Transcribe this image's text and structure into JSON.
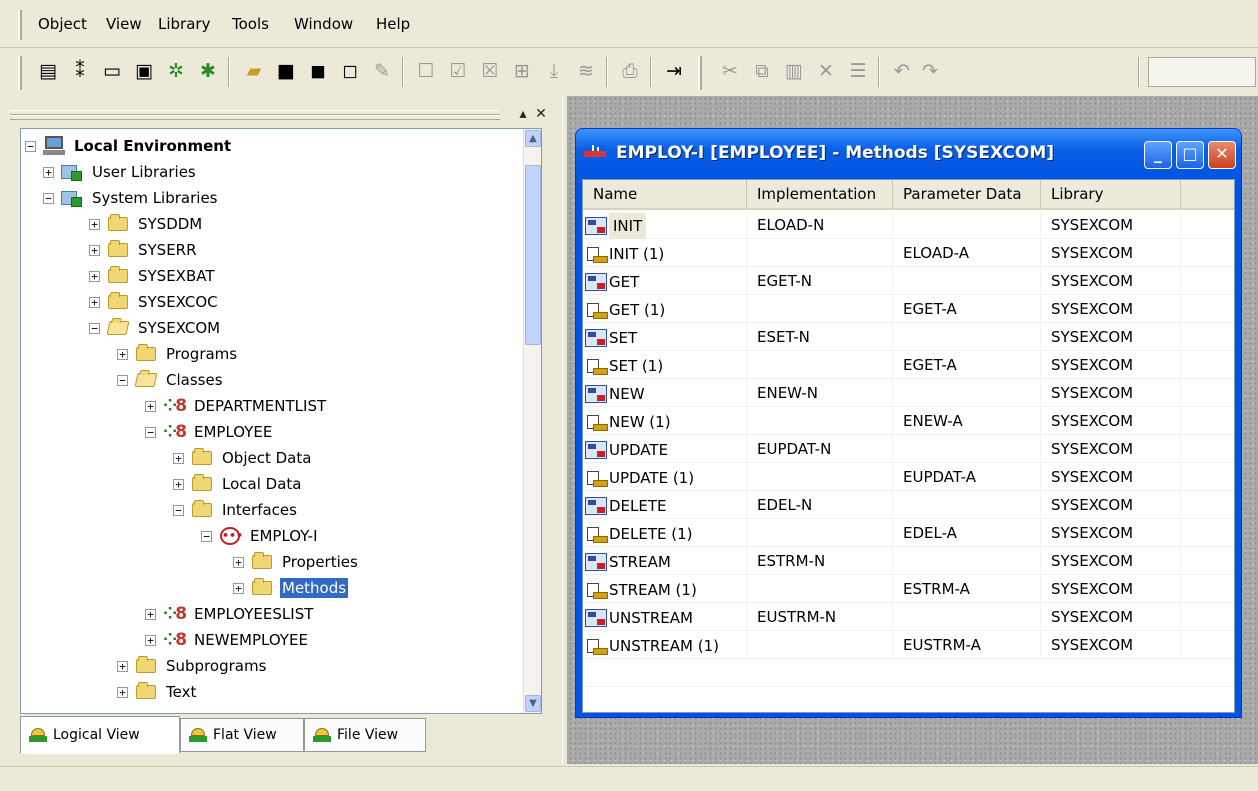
{
  "menu": {
    "items": [
      {
        "label": "Object"
      },
      {
        "label": "View"
      },
      {
        "label": "Library"
      },
      {
        "label": "Tools"
      },
      {
        "label": "Window"
      },
      {
        "label": "Help"
      }
    ]
  },
  "toolbar": {
    "buttons": [
      {
        "icon": "properties-icon"
      },
      {
        "icon": "tree-icon"
      },
      {
        "icon": "window-icon"
      },
      {
        "icon": "form-icon"
      },
      {
        "icon": "debug-icon"
      },
      {
        "icon": "debug2-icon"
      },
      {
        "icon": "open-icon"
      },
      {
        "icon": "save-icon"
      },
      {
        "icon": "save-all-icon"
      },
      {
        "icon": "new-icon"
      },
      {
        "icon": "edit-icon"
      },
      {
        "icon": "check-icon"
      },
      {
        "icon": "stow-icon"
      },
      {
        "icon": "catalog-icon"
      },
      {
        "icon": "run-icon"
      },
      {
        "icon": "step-icon"
      },
      {
        "icon": "test-icon"
      },
      {
        "icon": "print-icon"
      },
      {
        "icon": "exit-icon"
      },
      {
        "icon": "cut-icon"
      },
      {
        "icon": "copy-icon"
      },
      {
        "icon": "paste-icon"
      },
      {
        "icon": "delete-icon"
      },
      {
        "icon": "list-icon"
      },
      {
        "icon": "undo-icon"
      },
      {
        "icon": "redo-icon"
      }
    ]
  },
  "tree": {
    "root": "Local Environment",
    "user_libraries": "User Libraries",
    "system_libraries": "System Libraries",
    "sysddm": "SYSDDM",
    "syserr": "SYSERR",
    "sysexbat": "SYSEXBAT",
    "sysexcoc": "SYSEXCOC",
    "sysexcom": "SYSEXCOM",
    "programs": "Programs",
    "classes": "Classes",
    "departmentlist": "DEPARTMENTLIST",
    "employee": "EMPLOYEE",
    "object_data": "Object Data",
    "local_data": "Local Data",
    "interfaces": "Interfaces",
    "employ_i": "EMPLOY-I",
    "properties": "Properties",
    "methods": "Methods",
    "employeeslist": "EMPLOYEESLIST",
    "newemployee": "NEWEMPLOYEE",
    "subprograms": "Subprograms",
    "text": "Text"
  },
  "tabs": {
    "logical": "Logical View",
    "flat": "Flat View",
    "file": "File View"
  },
  "child_window": {
    "title": "EMPLOY-I [EMPLOYEE] - Methods  [SYSEXCOM]",
    "columns": {
      "name": "Name",
      "implementation": "Implementation",
      "parameter_data": "Parameter Data",
      "library": "Library"
    },
    "rows": [
      {
        "name": "INIT",
        "implementation": "ELOAD-N",
        "parameter": "",
        "library": "SYSEXCOM"
      },
      {
        "name": "INIT (1)",
        "implementation": "",
        "parameter": "ELOAD-A",
        "library": "SYSEXCOM"
      },
      {
        "name": "GET",
        "implementation": "EGET-N",
        "parameter": "",
        "library": "SYSEXCOM"
      },
      {
        "name": "GET (1)",
        "implementation": "",
        "parameter": "EGET-A",
        "library": "SYSEXCOM"
      },
      {
        "name": "SET",
        "implementation": "ESET-N",
        "parameter": "",
        "library": "SYSEXCOM"
      },
      {
        "name": "SET (1)",
        "implementation": "",
        "parameter": "EGET-A",
        "library": "SYSEXCOM"
      },
      {
        "name": "NEW",
        "implementation": "ENEW-N",
        "parameter": "",
        "library": "SYSEXCOM"
      },
      {
        "name": "NEW (1)",
        "implementation": "",
        "parameter": "ENEW-A",
        "library": "SYSEXCOM"
      },
      {
        "name": "UPDATE",
        "implementation": "EUPDAT-N",
        "parameter": "",
        "library": "SYSEXCOM"
      },
      {
        "name": "UPDATE (1)",
        "implementation": "",
        "parameter": "EUPDAT-A",
        "library": "SYSEXCOM"
      },
      {
        "name": "DELETE",
        "implementation": "EDEL-N",
        "parameter": "",
        "library": "SYSEXCOM"
      },
      {
        "name": "DELETE (1)",
        "implementation": "",
        "parameter": "EDEL-A",
        "library": "SYSEXCOM"
      },
      {
        "name": "STREAM",
        "implementation": "ESTRM-N",
        "parameter": "",
        "library": "SYSEXCOM"
      },
      {
        "name": "STREAM (1)",
        "implementation": "",
        "parameter": "ESTRM-A",
        "library": "SYSEXCOM"
      },
      {
        "name": "UNSTREAM",
        "implementation": "EUSTRM-N",
        "parameter": "",
        "library": "SYSEXCOM"
      },
      {
        "name": "UNSTREAM (1)",
        "implementation": "",
        "parameter": "EUSTRM-A",
        "library": "SYSEXCOM"
      }
    ]
  },
  "colors": {
    "selection": "#316ac5",
    "title_bar": "#0054e3",
    "chrome": "#ece9d8"
  }
}
